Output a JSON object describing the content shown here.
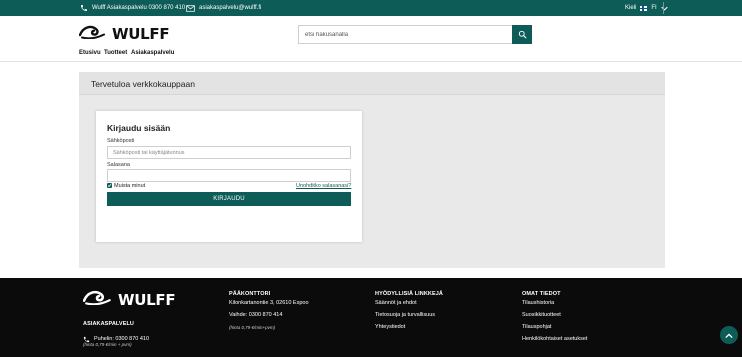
{
  "topbar": {
    "phone_text": "Wulff Asiakaspalvelu 0300 870 410",
    "email_text": "asiakaspalvelu@wulff.fi",
    "language_label": "Kieli",
    "language_code": "FI"
  },
  "header": {
    "logo_text": "WULFF",
    "nav": [
      "Etusivu",
      "Tuotteet",
      "Asiakaspalvelu"
    ],
    "search_placeholder": "etsi hakusanalla"
  },
  "main": {
    "panel_title": "Tervetuloa verkkokauppaan",
    "login": {
      "title": "Kirjaudu sisään",
      "email_label": "Sähköposti",
      "email_placeholder": "Sähköposti tai käyttäjätunnus",
      "password_label": "Salasana",
      "remember_label": "Muista minut",
      "remember_checked": true,
      "forgot_link": "Unohditko salasanasi?",
      "submit_label": "KIRJAUDU"
    }
  },
  "footer": {
    "logo_text": "WULFF",
    "service_heading": "ASIAKASPALVELU",
    "service_phone": "Puhelin: 0300 870 410",
    "service_note": "(hinta 0,79 €/min + pvm)",
    "hq_heading": "PÄÄKONTTORI",
    "hq_address": "Kilonkartanontie 3, 02610 Espoo",
    "hq_switchboard": "Vaihde: 0300 870 414",
    "hq_note": "(hinta 0,79 €/min+pvm)",
    "links_heading": "HYÖDYLLISIÄ LINKKEJÄ",
    "links": [
      "Säännöt ja ehdot",
      "Tietosuoja ja turvallisuus",
      "Yhteystiedot"
    ],
    "own_heading": "OMAT TIEDOT",
    "own_links": [
      "Tilaushistoria",
      "Suosikkituotteet",
      "Tilauspohjat",
      "Henkilökohtaiset asetukset"
    ]
  },
  "colors": {
    "brand": "#0e5c57",
    "footer_bg": "#0b0b0b",
    "panel_bg": "#e9e9e9"
  },
  "icons": [
    "phone-icon",
    "mail-icon",
    "flag-fi-icon",
    "chevron-down-icon",
    "search-icon",
    "wave-logo-icon",
    "chevron-up-icon"
  ]
}
